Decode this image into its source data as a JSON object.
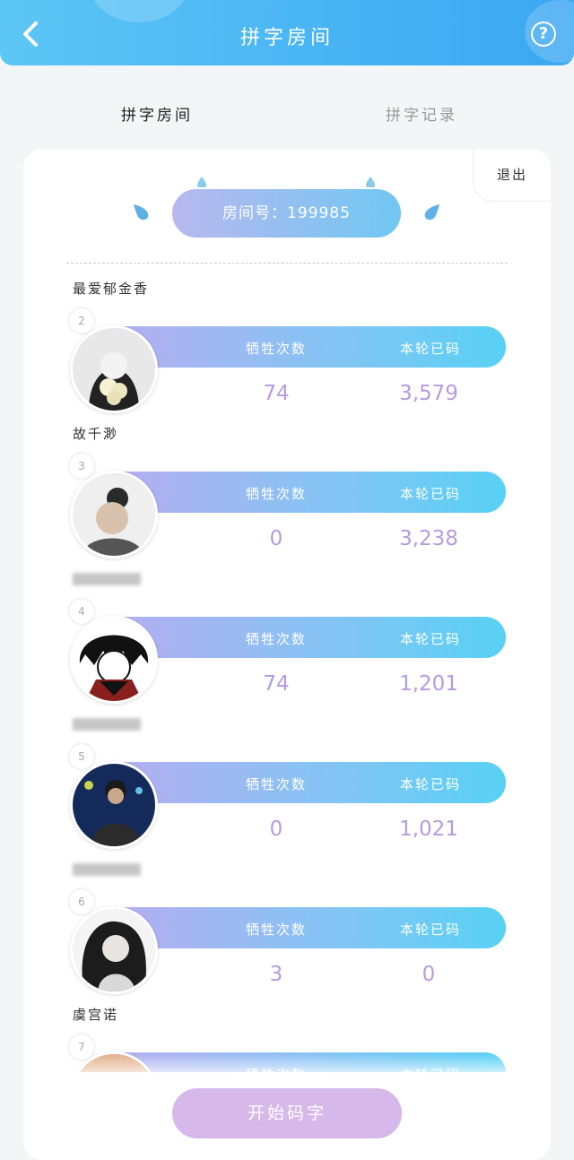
{
  "header": {
    "title": "拼字房间"
  },
  "tabs": [
    {
      "label": "拼字房间"
    },
    {
      "label": "拼字记录"
    }
  ],
  "room": {
    "exit_label": "退出",
    "room_label": "房间号：199985"
  },
  "stat_labels": {
    "first": "牺牲次数",
    "second": "本轮已码"
  },
  "players": [
    {
      "name": "最爱郁金香",
      "rank": "2",
      "sacrifice": "74",
      "words": "3,579"
    },
    {
      "name": "故千渺",
      "rank": "3",
      "sacrifice": "0",
      "words": "3,238"
    },
    {
      "name": "",
      "rank": "4",
      "sacrifice": "74",
      "words": "1,201"
    },
    {
      "name": "",
      "rank": "5",
      "sacrifice": "0",
      "words": "1,021"
    },
    {
      "name": "",
      "rank": "6",
      "sacrifice": "3",
      "words": "0"
    },
    {
      "name": "虞宫诺",
      "rank": "7",
      "sacrifice": "",
      "words": ""
    }
  ],
  "start_button": {
    "label": "开始码字"
  },
  "colors": {
    "header": "#3aa7f2",
    "value": "#b79ae0",
    "start": "#d6b8ea"
  }
}
